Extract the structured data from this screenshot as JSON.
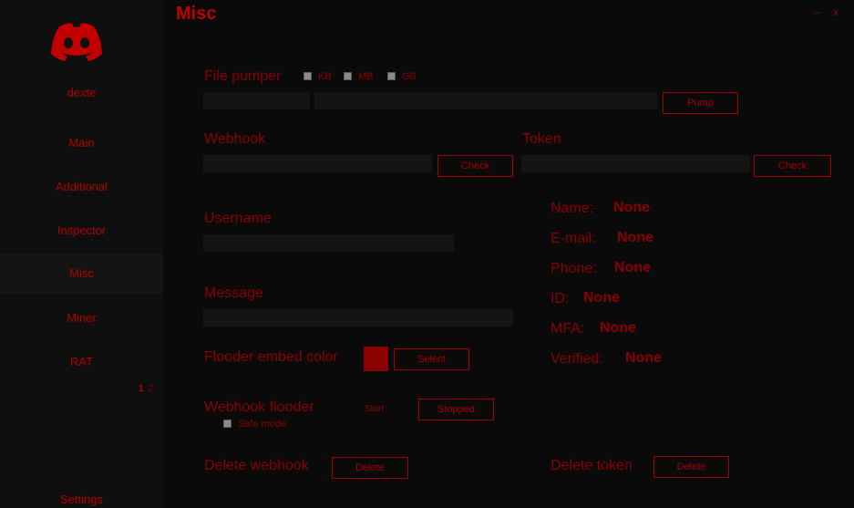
{
  "window": {
    "title": "Misc",
    "minimize": "–",
    "close": "x"
  },
  "sidebar": {
    "user": "dexte",
    "items": [
      {
        "label": "Main"
      },
      {
        "label": "Additional"
      },
      {
        "label": "Inspector"
      },
      {
        "label": "Misc"
      },
      {
        "label": "Miner"
      },
      {
        "label": "RAT"
      }
    ],
    "pages": [
      "1",
      "2"
    ],
    "settings": "Settings"
  },
  "file_pumper": {
    "label": "File pumper",
    "units": [
      "KB",
      "MB",
      "GB"
    ],
    "button": "Pump"
  },
  "webhook": {
    "label": "Webhook",
    "button": "Check"
  },
  "token": {
    "label": "Token",
    "button": "Check"
  },
  "username": {
    "label": "Username"
  },
  "message": {
    "label": "Message"
  },
  "embed_color": {
    "label": "Flooder embed color",
    "color": "#8b0000",
    "button": "Select"
  },
  "flooder": {
    "label": "Webhook flooder",
    "start": "Start",
    "status": "Stopped",
    "safe_mode": "Safe mode"
  },
  "delete_webhook": {
    "label": "Delete webhook",
    "button": "Delete"
  },
  "delete_token": {
    "label": "Delete token",
    "button": "Delete"
  },
  "token_info": {
    "name_label": "Name:",
    "name_value": "None",
    "email_label": "E-mail:",
    "email_value": "None",
    "phone_label": "Phone:",
    "phone_value": "None",
    "id_label": "ID:",
    "id_value": "None",
    "mfa_label": "MFA:",
    "mfa_value": "None",
    "verified_label": "Verified:",
    "verified_value": "None"
  },
  "colors": {
    "accent": "#8b0000",
    "background": "#0b0b0b",
    "sidebar": "#0f0f0f",
    "field": "#141414"
  }
}
